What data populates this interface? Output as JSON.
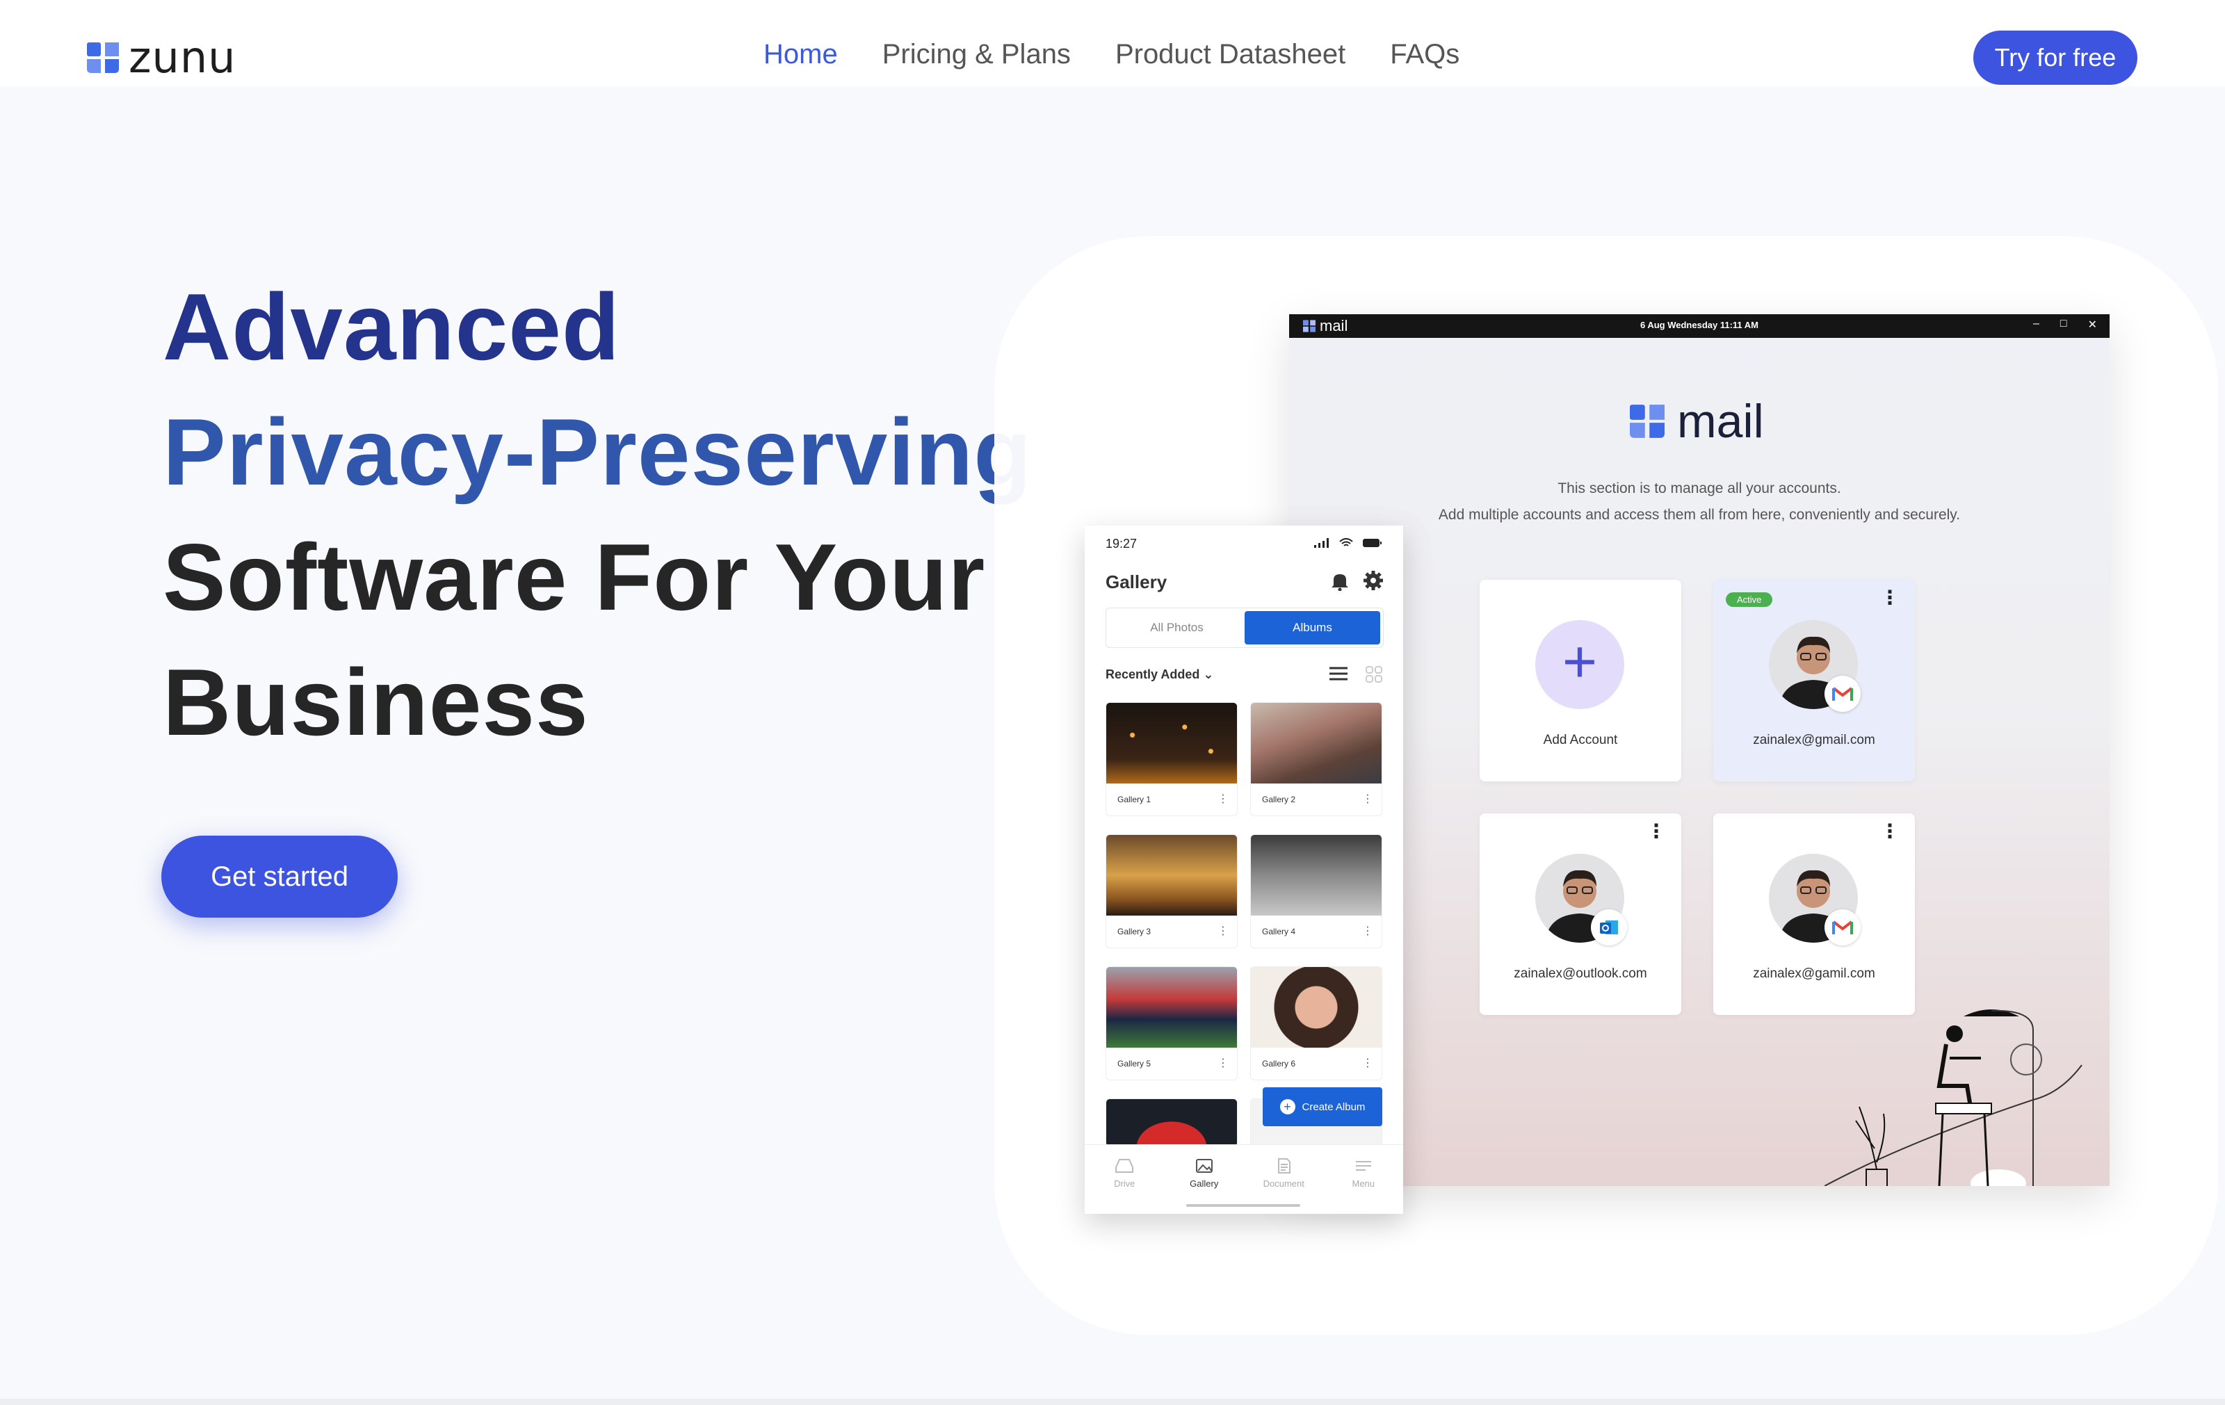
{
  "brand": {
    "name": "zunu",
    "accent": "#3d54e0"
  },
  "nav": {
    "links": [
      {
        "label": "Home",
        "active": true
      },
      {
        "label": "Pricing & Plans",
        "active": false
      },
      {
        "label": "Product Datasheet",
        "active": false
      },
      {
        "label": "FAQs",
        "active": false
      }
    ],
    "cta": "Try for free"
  },
  "hero": {
    "line1": "Advanced",
    "line2": "Privacy-Preserving",
    "line3": "Software For Your",
    "line4": "Business",
    "cta": "Get started"
  },
  "mail_window": {
    "app_title": "mail",
    "date": "6 Aug Wednesday 11:11 AM",
    "logo_text": "mail",
    "desc1": "This section is to manage all your accounts.",
    "desc2": "Add multiple accounts and access them all from here, conveniently and securely.",
    "add_account": "Add Account",
    "accounts": [
      {
        "email": "zainalex@gmail.com",
        "status": "Active",
        "provider": "gmail-icon"
      },
      {
        "email": "zainalex@outlook.com",
        "provider": "outlook-icon"
      },
      {
        "email": "zainalex@gamil.com",
        "provider": "gmail-icon"
      }
    ]
  },
  "phone": {
    "time": "19:27",
    "title": "Gallery",
    "tabs": [
      "All Photos",
      "Albums"
    ],
    "sort": "Recently Added",
    "galleries": [
      "Gallery 1",
      "Gallery 2",
      "Gallery 3",
      "Gallery 4",
      "Gallery 5",
      "Gallery 6"
    ],
    "create_album": "Create Album",
    "bottom_nav": [
      "Drive",
      "Gallery",
      "Document",
      "Menu"
    ]
  }
}
